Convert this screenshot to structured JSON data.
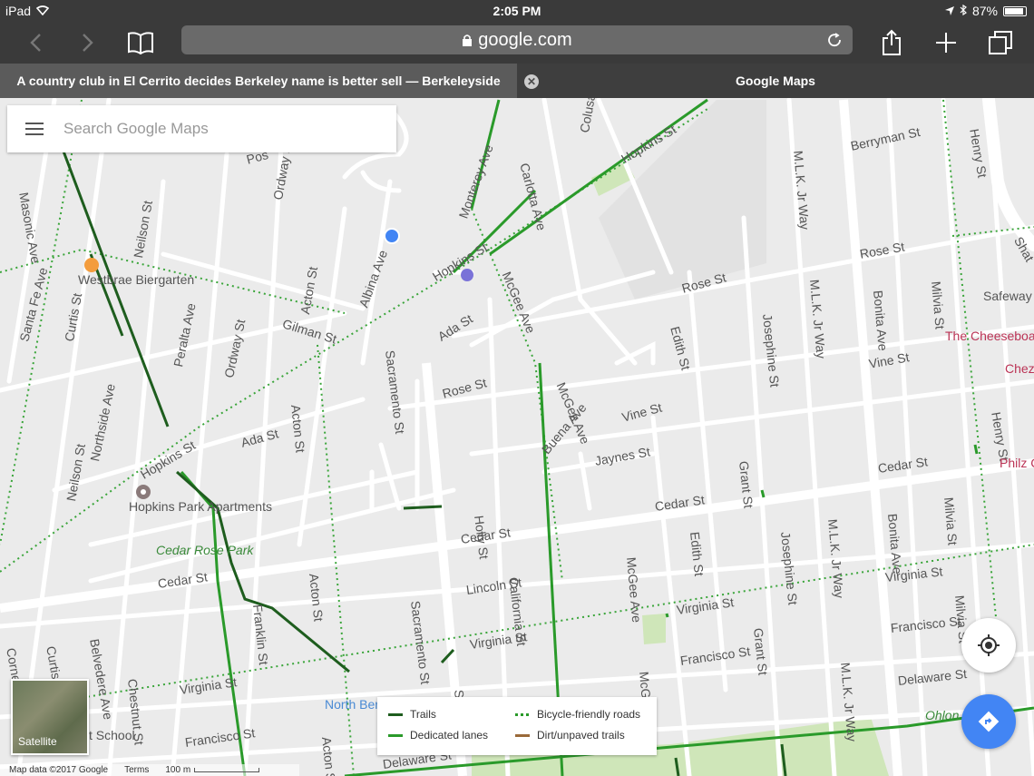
{
  "status": {
    "device": "iPad",
    "time": "2:05 PM",
    "battery": "87%"
  },
  "browser": {
    "url": "google.com",
    "tabs": [
      {
        "label": "A country club in El Cerrito decides Berkeley name is better sell — Berkeleyside"
      },
      {
        "label": "Google Maps"
      }
    ]
  },
  "search": {
    "placeholder": "Search Google Maps"
  },
  "streets": {
    "hopkins1": "Hopkins St",
    "hopkins2": "Hopkins St",
    "hopkins3": "Hopkins St",
    "berryman": "Berryman St",
    "rose1": "Rose St",
    "rose2": "Rose St",
    "rose3": "Rose St",
    "ada1": "Ada St",
    "ada2": "Ada St",
    "vine1": "Vine St",
    "vine2": "Vine St",
    "jaynes": "Jaynes St",
    "cedar1": "Cedar St",
    "cedar2": "Cedar St",
    "cedar3": "Cedar St",
    "cedar4": "Cedar St",
    "lincoln": "Lincoln St",
    "virginia1": "Virginia St",
    "virginia2": "Virginia St",
    "virginia3": "Virginia St",
    "virginia4": "Virginia St",
    "francisco1": "Francisco St",
    "francisco2": "Francisco St",
    "francisco3": "Francisco St",
    "delaware1": "Delaware St",
    "delaware2": "Delaware St",
    "gilman": "Gilman St",
    "masonic": "Masonic Ave",
    "santafe": "Santa Fe Ave",
    "curtis1": "Curtis St",
    "curtis2": "Curtis St",
    "neilson1": "Neilson St",
    "neilson2": "Neilson St",
    "northside": "Northside Ave",
    "peralta": "Peralta Ave",
    "ordway1": "Ordway St",
    "ordway2": "Ordway St",
    "acton1": "Acton St",
    "acton2": "Acton St",
    "acton3": "Acton St",
    "acton4": "Acton St",
    "albina": "Albina Ave",
    "sacramento1": "Sacramento St",
    "sacramento2": "Sacramento St",
    "monterey": "Monterey Ave",
    "carlotta": "Carlotta Ave",
    "colusa": "Colusa Ave",
    "mcgee1": "McGee Ave",
    "mcgee2": "McGee Ave",
    "mcgee3": "McGee Ave",
    "mcgee4": "McGee Ave",
    "buena": "Buena Ave",
    "holly": "Holly St",
    "california": "California St",
    "edith1": "Edith St",
    "edith2": "Edith St",
    "grant1": "Grant St",
    "grant2": "Grant St",
    "josephine1": "Josephine St",
    "josephine2": "Josephine St",
    "mlk1": "M.L.K. Jr Way",
    "mlk2": "M.L.K. Jr Way",
    "mlk3": "M.L.K. Jr Way",
    "mlk4": "M.L.K. Jr Way",
    "bonita1": "Bonita Ave",
    "bonita2": "Bonita Ave",
    "milvia1": "Milvia St",
    "milvia2": "Milvia St",
    "milvia3": "Milvia St",
    "henry1": "Henry St",
    "henry2": "Henry St",
    "franklin": "Franklin St",
    "chestnut": "Chestnut St",
    "belvedere": "Belvedere Ave",
    "cornell": "Cornell Ave",
    "posen": "Pos",
    "shattuck": "Shat",
    "ordwayfrag": "Ordway St",
    "sacfrag": "Sa"
  },
  "pois": {
    "westbrae": "Westbrae Biergarten",
    "hopkinspark": "Hopkins Park Apartments",
    "cedarrose": "Cedar Rose Park",
    "safeway": "Safeway",
    "cheesebo": "The Cheeseboa",
    "chez": "Chez",
    "philz": "Philz C",
    "northber": "North Ber",
    "school": "t School",
    "ohlone": "Ohlon"
  },
  "legend": {
    "trails": "Trails",
    "dedicated": "Dedicated lanes",
    "friendly": "Bicycle-friendly roads",
    "dirt": "Dirt/unpaved trails",
    "colors": {
      "trails": "#1e5d1e",
      "dedicated": "#2a9a2a",
      "friendly": "#2a9a2a",
      "dirt": "#9a6a3a"
    }
  },
  "controls": {
    "satellite": "Satellite"
  },
  "footer": {
    "mapdata": "Map data ©2017 Google",
    "terms": "Terms",
    "scale": "100 m"
  }
}
